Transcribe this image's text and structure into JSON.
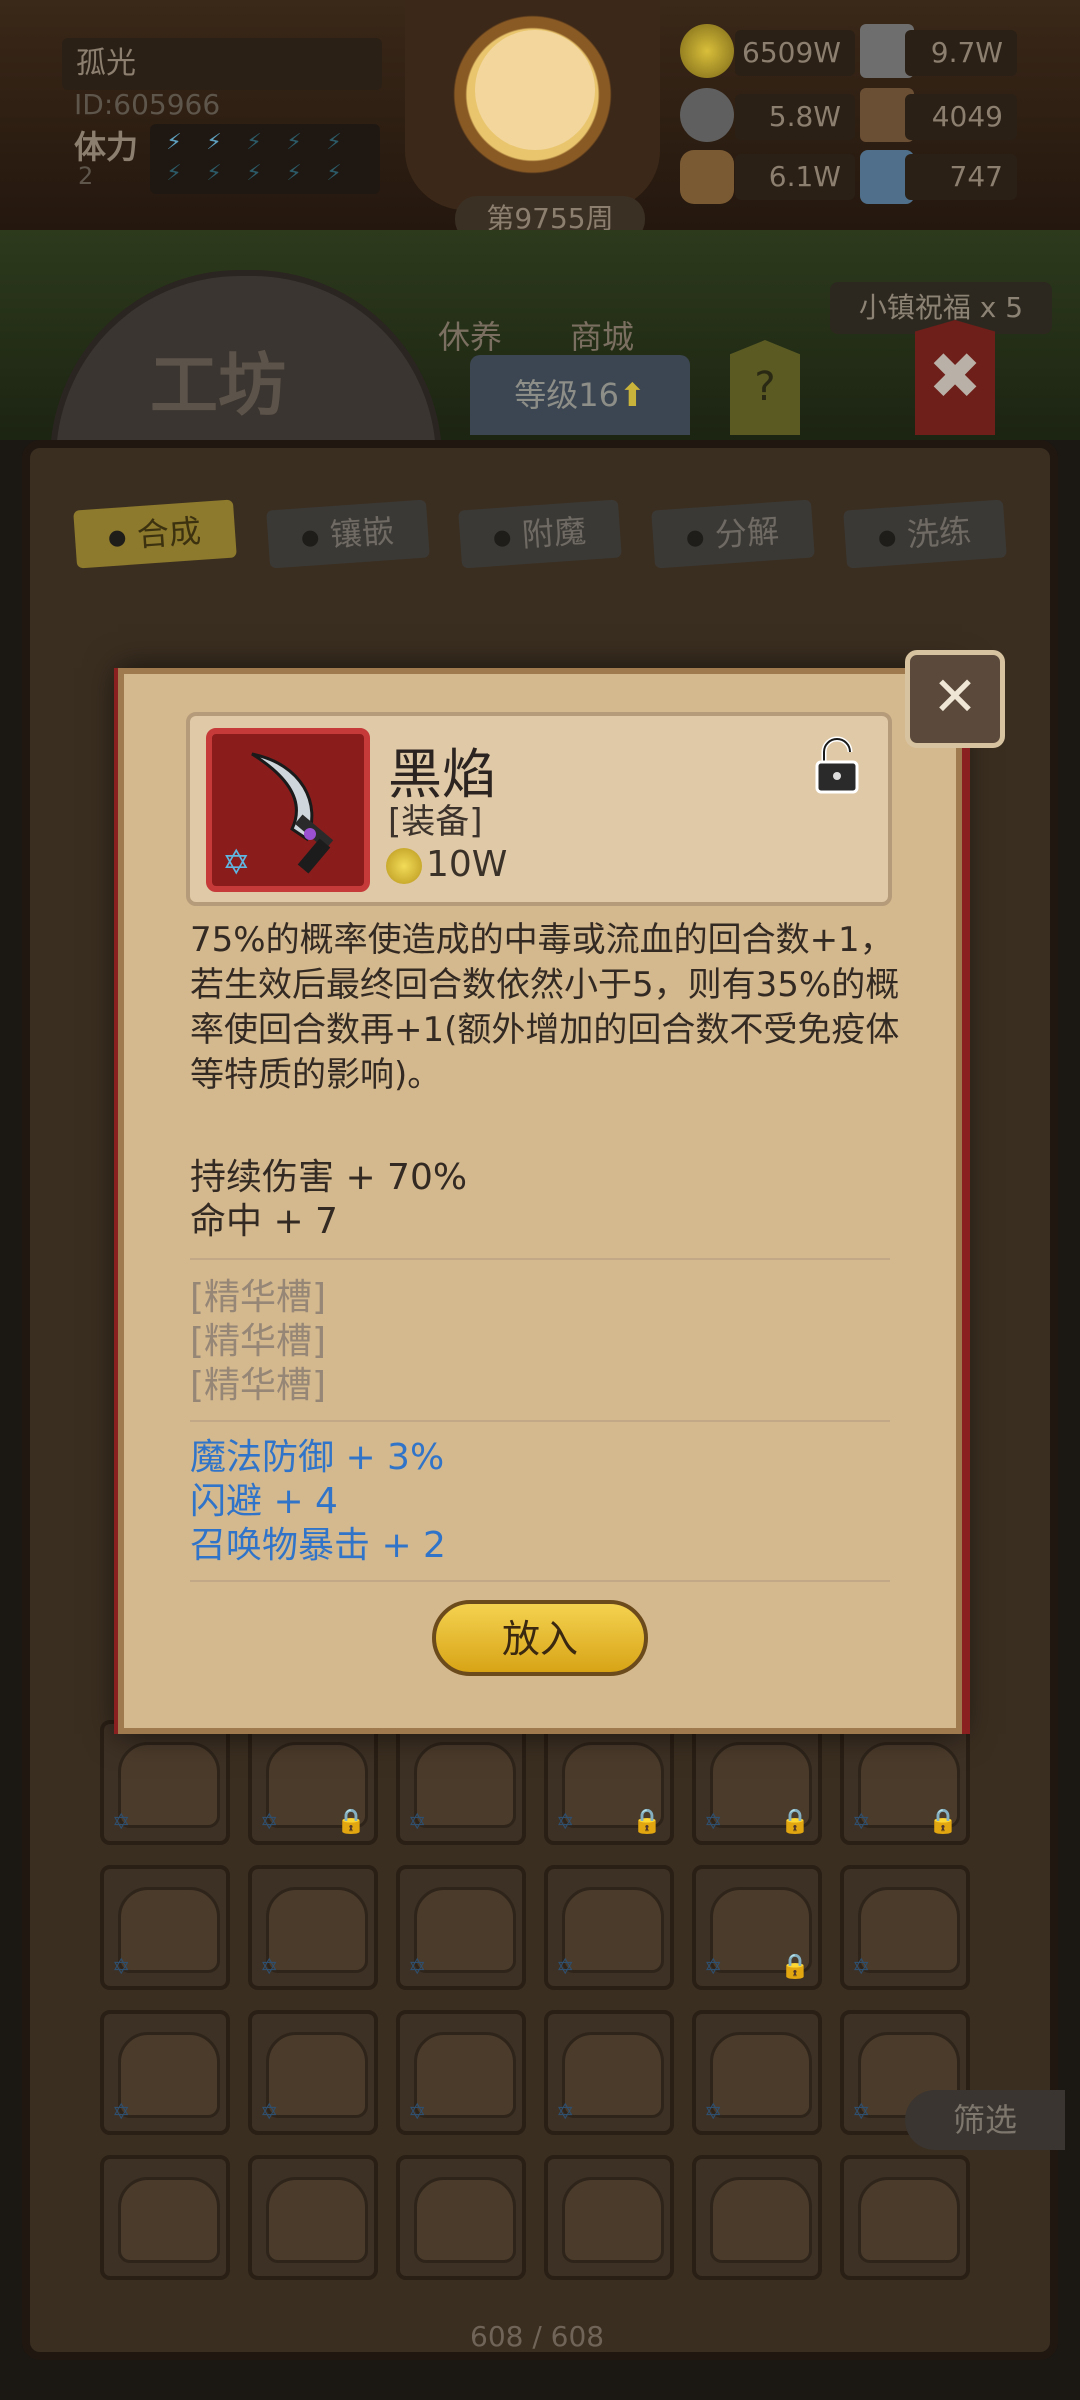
{
  "player": {
    "name": "孤光",
    "id": "ID:605966",
    "stamina_label": "体力",
    "stamina_value": "2",
    "stamina_full": 2,
    "stamina_max": 10
  },
  "week": "第9755周",
  "resources": [
    {
      "name": "gold-coin",
      "value": "6509W"
    },
    {
      "name": "iron-ingot",
      "value": "9.7W"
    },
    {
      "name": "stone",
      "value": "5.8W"
    },
    {
      "name": "leather",
      "value": "4049"
    },
    {
      "name": "wood",
      "value": "6.1W"
    },
    {
      "name": "crystal",
      "value": "747"
    }
  ],
  "town_nav": {
    "rest": "休养",
    "shop": "商城",
    "blessing": "小镇祝福 x 5"
  },
  "workshop": {
    "title": "工坊",
    "level": "等级16",
    "help": "?",
    "tabs": [
      {
        "label": "合成",
        "active": true
      },
      {
        "label": "镶嵌",
        "active": false
      },
      {
        "label": "附魔",
        "active": false
      },
      {
        "label": "分解",
        "active": false
      },
      {
        "label": "洗练",
        "active": false
      }
    ],
    "filter": "筛选",
    "count": "608 / 608"
  },
  "item": {
    "name": "黑焰",
    "type": "[装备]",
    "price": "10W",
    "description": "75%的概率使造成的中毒或流血的回合数+1，若生效后最终回合数依然小于5，则有35%的概率使回合数再+1(额外增加的回合数不受免疫体等特质的影响)。",
    "stats": [
      "持续伤害 + 70%",
      "命中 + 7"
    ],
    "slots": [
      "[精华槽]",
      "[精华槽]",
      "[精华槽]"
    ],
    "bonuses": [
      "魔法防御 + 3%",
      "闪避 + 4",
      "召唤物暴击 + 2"
    ],
    "place_button": "放入"
  },
  "colors": {
    "accent_gold": "#f4d250",
    "bonus_blue": "#2f74c9",
    "item_frame_red": "#c63a3a"
  }
}
